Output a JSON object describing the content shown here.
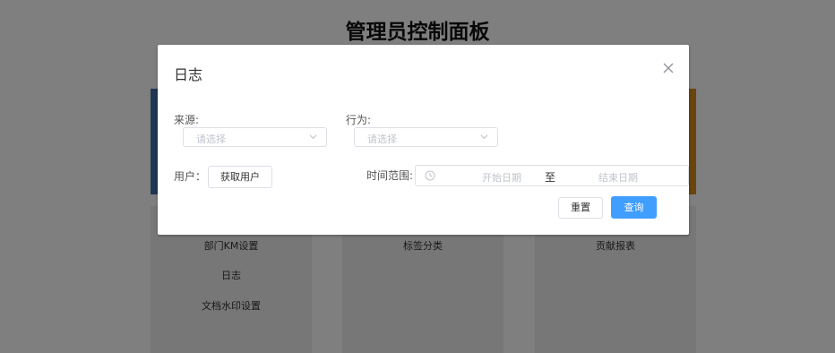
{
  "page": {
    "title": "管理员控制面板",
    "columns": [
      {
        "items": [
          "部门KM设置",
          "日志",
          "文档水印设置"
        ]
      },
      {
        "items": [
          "标签分类"
        ]
      },
      {
        "items": [
          "贡献报表"
        ]
      }
    ],
    "card_colors": {
      "left": "#3f6fa8",
      "right": "#d38b1a"
    }
  },
  "dialog": {
    "title": "日志",
    "close_icon": "close-icon",
    "filters": {
      "source_label": "来源:",
      "source_placeholder": "请选择",
      "action_label": "行为:",
      "action_placeholder": "请选择",
      "user_label": "用户：",
      "get_user_button": "获取用户",
      "time_range_label": "时间范围:",
      "start_date_placeholder": "开始日期",
      "range_separator": "至",
      "end_date_placeholder": "结束日期"
    },
    "actions": {
      "reset_label": "重置",
      "search_label": "查询"
    },
    "colors": {
      "primary": "#409eff",
      "overlay": "rgba(0,0,0,0.5)"
    }
  }
}
